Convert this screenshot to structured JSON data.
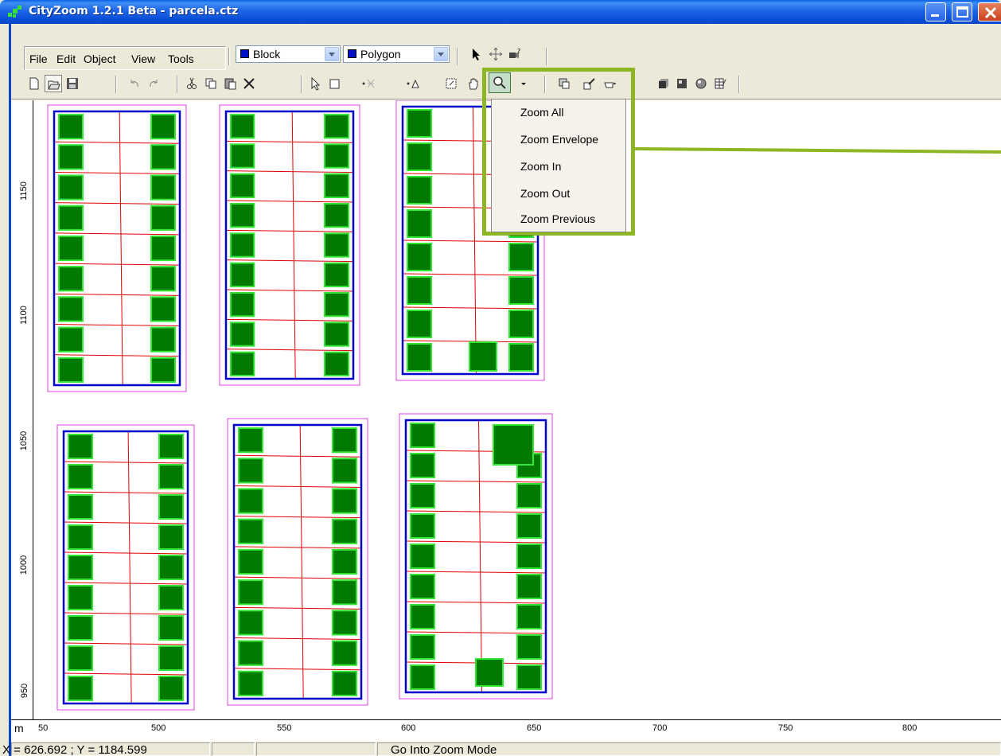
{
  "window": {
    "title": "CityZoom 1.2.1 Beta - parcela.ctz"
  },
  "menu": [
    "File",
    "Edit",
    "Object",
    "View",
    "Tools"
  ],
  "toolbar": {
    "layer_combo": "Block",
    "shape_combo": "Polygon"
  },
  "zoom_menu": {
    "items": [
      "Zoom All",
      "Zoom Envelope",
      "Zoom In",
      "Zoom Out",
      "Zoom Previous"
    ]
  },
  "ruler": {
    "unit": "m",
    "y_ticks": [
      "1150",
      "1100",
      "1050",
      "1000",
      "950"
    ],
    "x_ticks": [
      "50",
      "500",
      "550",
      "600",
      "650",
      "700",
      "750",
      "800"
    ]
  },
  "status": {
    "coords": "X = 626.692 ;  Y = 1184.599",
    "message": "Go Into Zoom Mode"
  },
  "colors": {
    "block_outline": "#0000CC",
    "envelope": "#E040E0",
    "parcel_lines": "#E00000",
    "building_fill": "#007A00",
    "building_outline": "#33E633",
    "callout": "#8DB524"
  }
}
